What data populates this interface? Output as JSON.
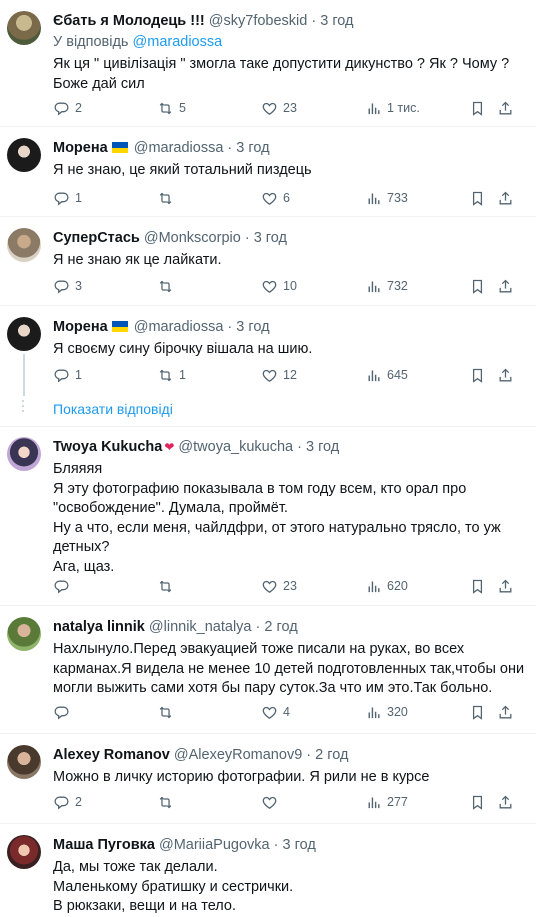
{
  "tweets": [
    {
      "name": "Єбать я Молодець !!!",
      "handle": "@sky7fobeskid",
      "time": "3 год",
      "reply_prefix": "У відповідь",
      "reply_handle": "@maradiossa",
      "text": "Як ця \" цивілізація \" змогла таке допустити дикунство ? Як ? Чому ?\nБоже дай сил",
      "replies": "2",
      "retweets": "5",
      "likes": "23",
      "views": "1 тис."
    },
    {
      "name": "Морена",
      "handle": "@maradiossa",
      "time": "3 год",
      "flag": true,
      "text": "Я не знаю, це який тотальний пиздець",
      "replies": "1",
      "retweets": "",
      "likes": "6",
      "views": "733"
    },
    {
      "name": "СуперСтась",
      "handle": "@Monkscorpio",
      "time": "3 год",
      "text": "Я не знаю як це лайкати.",
      "replies": "3",
      "retweets": "",
      "likes": "10",
      "views": "732"
    },
    {
      "name": "Морена",
      "handle": "@maradiossa",
      "time": "3 год",
      "flag": true,
      "text": "Я своєму сину бірочку вішала на шию.",
      "replies": "1",
      "retweets": "1",
      "likes": "12",
      "views": "645"
    },
    {
      "name": "Twoya Kukucha",
      "name_emoji": "❤",
      "handle": "@twoya_kukucha",
      "time": "3 год",
      "text": "Бляяяя\nЯ эту фотографию показывала в том году всем, кто орал про \"освобождение\". Думала, проймёт.\nНу а что, если меня, чайлдфри, от этого натурально трясло, то уж детных?\nАга, щаз.",
      "replies": "",
      "retweets": "",
      "likes": "23",
      "views": "620"
    },
    {
      "name": "natalya linnik",
      "handle": "@linnik_natalya",
      "time": "2 год",
      "text": "Нахлынуло.Перед эвакуацией тоже писали на руках, во всех карманах.Я видела не менее 10 детей подготовленных так,чтобы они могли выжить сами хотя бы пару суток.За что им это.Так больно.",
      "replies": "",
      "retweets": "",
      "likes": "4",
      "views": "320"
    },
    {
      "name": "Alexey Romanov",
      "handle": "@AlexeyRomanov9",
      "time": "2 год",
      "text": "Можно в личку историю фотографии. Я рили не в курсе",
      "replies": "2",
      "retweets": "",
      "likes": "",
      "views": "277"
    },
    {
      "name": "Маша Пуговка",
      "handle": "@MariiaPugovka",
      "time": "3 год",
      "text": "Да, мы тоже так делали.\nМаленькому братишку и сестрички.\nВ рюкзаки, вещи и на тело."
    }
  ],
  "show_replies": "Показати відповіді",
  "colors": {
    "accent": "#1d9bf0",
    "secondary_text": "#536471",
    "divider": "#eff3f4",
    "thread_line": "#cfd9de",
    "flag_blue": "#0057b7",
    "flag_yellow": "#ffd700"
  }
}
